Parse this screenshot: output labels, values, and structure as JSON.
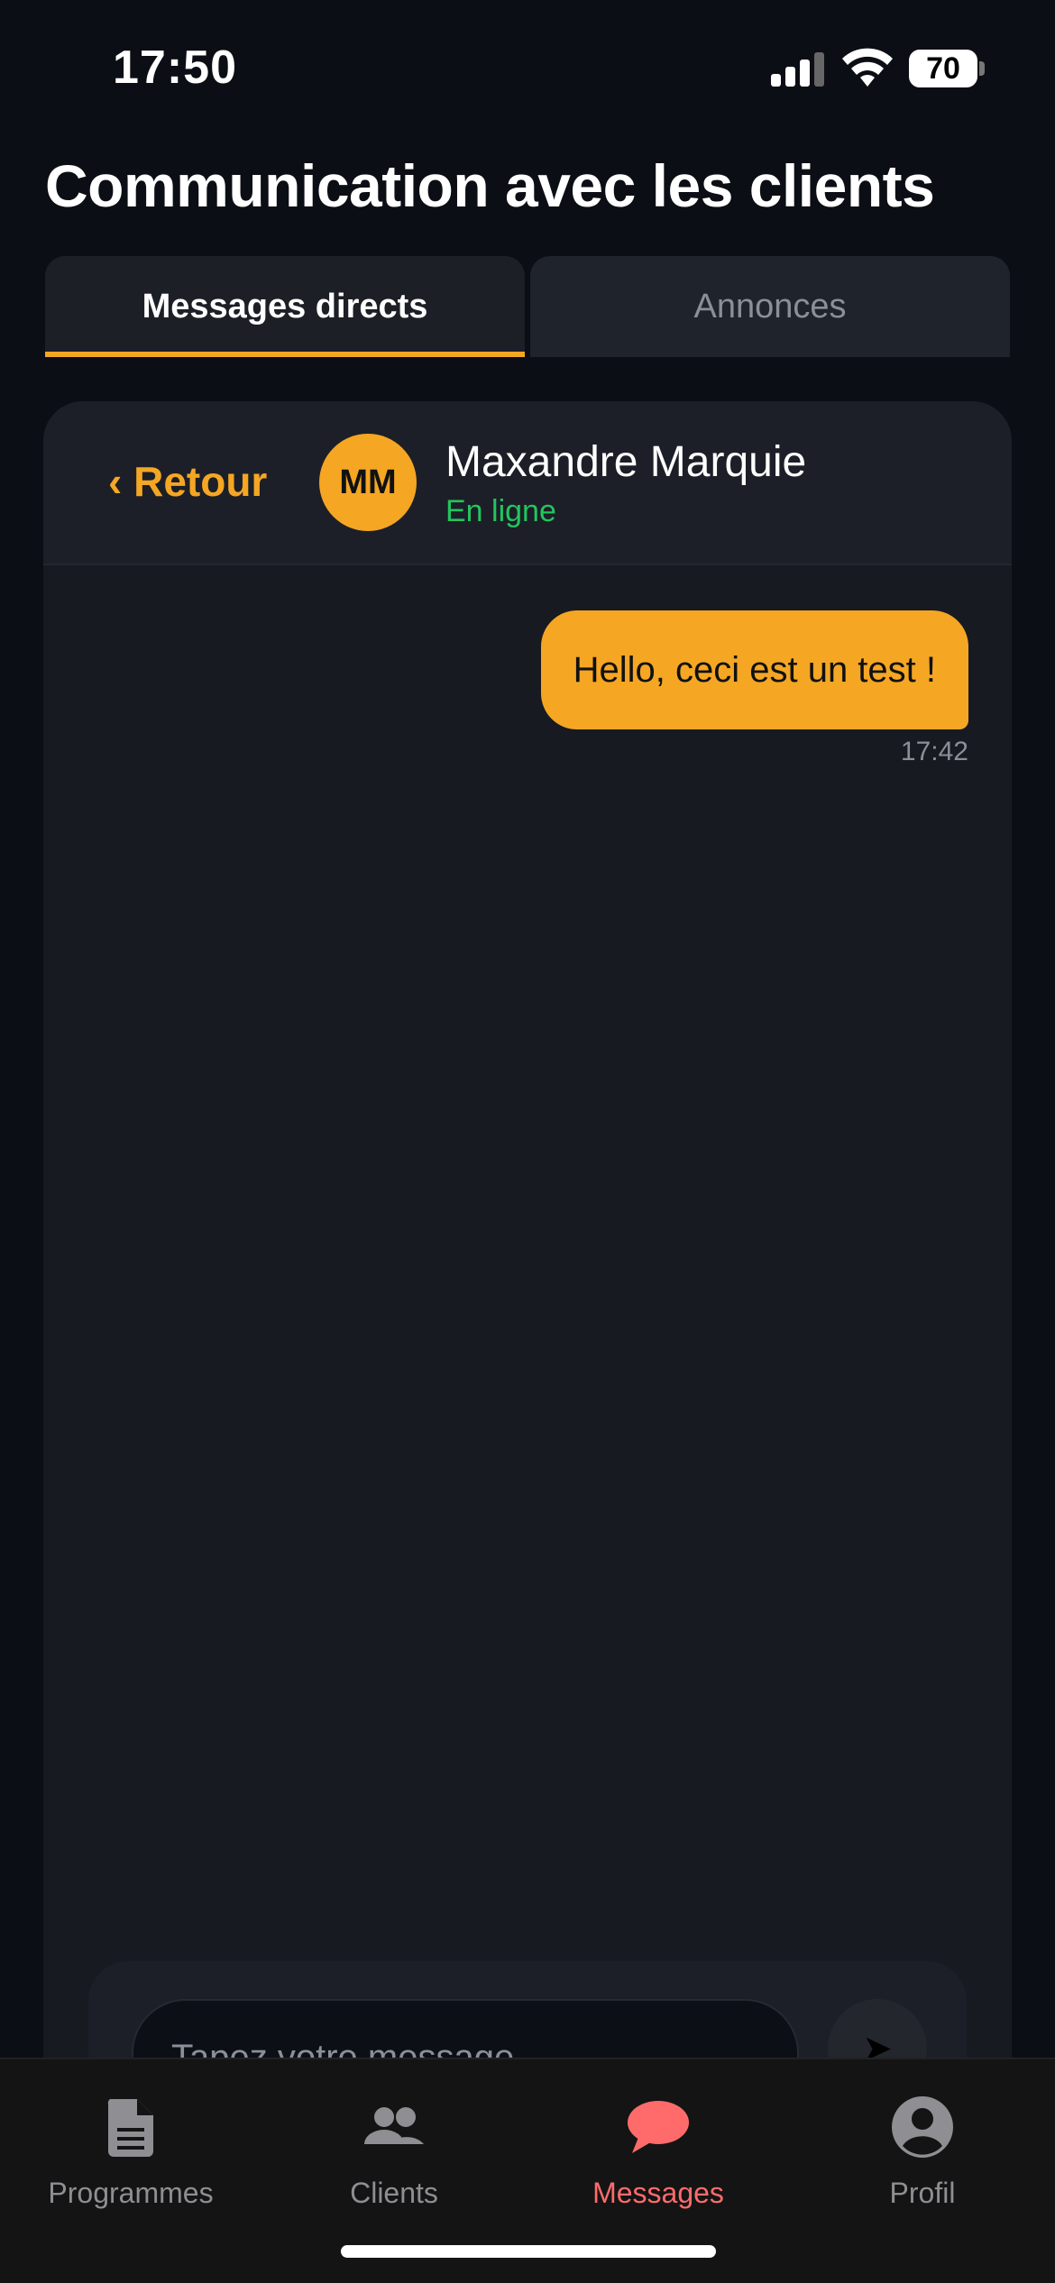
{
  "status_bar": {
    "time": "17:50",
    "battery": "70"
  },
  "page": {
    "title": "Communication avec les clients"
  },
  "tabs": [
    {
      "label": "Messages directs",
      "active": true
    },
    {
      "label": "Annonces",
      "active": false
    }
  ],
  "chat": {
    "back_label": "‹ Retour",
    "contact": {
      "initials": "MM",
      "name": "Maxandre Marquie",
      "status": "En ligne"
    },
    "messages": [
      {
        "text": "Hello, ceci est un test !",
        "time": "17:42",
        "outgoing": true
      }
    ],
    "composer": {
      "placeholder": "Tapez votre message...",
      "send_icon": "➤"
    }
  },
  "nav": [
    {
      "label": "Programmes",
      "icon": "document-icon"
    },
    {
      "label": "Clients",
      "icon": "people-icon"
    },
    {
      "label": "Messages",
      "icon": "chat-bubble-icon",
      "active": true
    },
    {
      "label": "Profil",
      "icon": "user-circle-icon"
    }
  ],
  "colors": {
    "accent": "#f5a623",
    "online": "#22c55e",
    "active_nav": "#ff6b6b",
    "background": "#0b0e14"
  }
}
